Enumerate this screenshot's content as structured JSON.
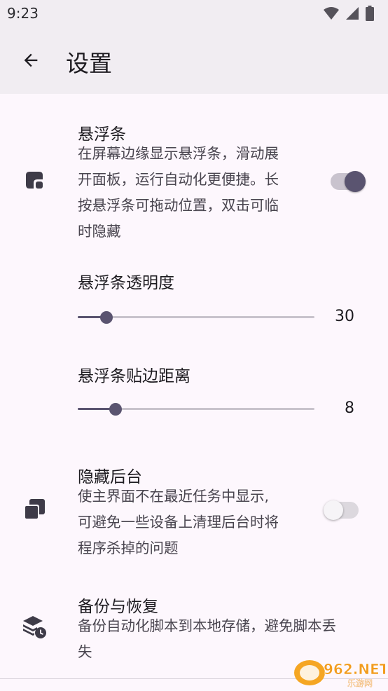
{
  "status_bar": {
    "time": "9:23",
    "icons": [
      "wifi-icon",
      "signal-icon",
      "battery-icon"
    ]
  },
  "app_bar": {
    "title": "设置",
    "back_icon": "arrow-back-icon"
  },
  "settings": {
    "floating_bar": {
      "icon": "floating-window-icon",
      "title": "悬浮条",
      "desc_lines": [
        "在屏幕边缘显示悬浮条，滑动展",
        "开面板，运行自动化更便捷。长",
        "按悬浮条可拖动位置，双击可临",
        "时隐藏"
      ],
      "enabled": true
    },
    "opacity": {
      "label": "悬浮条透明度",
      "value": "30",
      "fraction": 0.12
    },
    "edge_distance": {
      "label": "悬浮条贴边距离",
      "value": "8",
      "fraction": 0.16
    },
    "hide_background": {
      "icon": "stacked-windows-icon",
      "title": "隐藏后台",
      "desc_lines": [
        "使主界面不在最近任务中显示,",
        "可避免一些设备上清理后台时将",
        "程序杀掉的问题"
      ],
      "enabled": false
    },
    "backup": {
      "icon": "backup-restore-icon",
      "title": "备份与恢复",
      "desc_lines": [
        "备份自动化脚本到本地存储，避免脚本丢",
        "失"
      ]
    }
  },
  "watermark": {
    "main": "962.NET",
    "sub": "乐游网"
  },
  "colors": {
    "accent": "#5a5470",
    "background": "#fdf7fd",
    "app_bar": "#f1edf2"
  }
}
